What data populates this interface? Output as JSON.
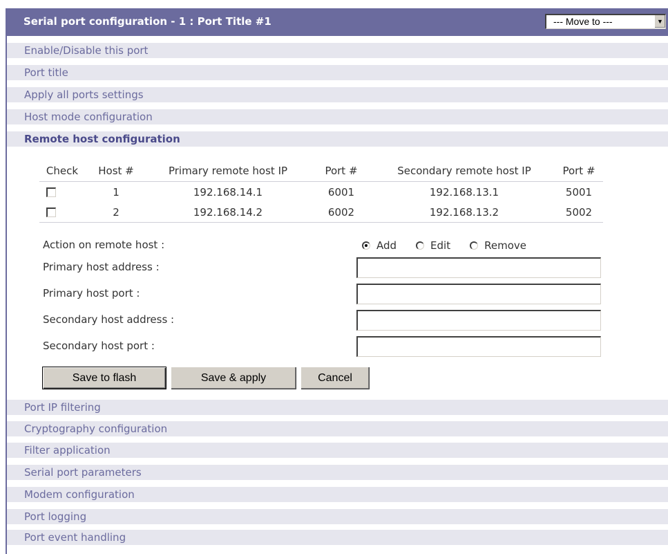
{
  "header": {
    "title": "Serial port configuration - 1 : Port Title #1",
    "move_to": "--- Move to ---"
  },
  "sections_top": [
    "Enable/Disable this port",
    "Port title",
    "Apply all ports settings",
    "Host mode configuration",
    "Remote host configuration"
  ],
  "hosts_table": {
    "columns": [
      "Check",
      "Host #",
      "Primary remote host IP",
      "Port #",
      "Secondary remote host IP",
      "Port #"
    ],
    "rows": [
      {
        "host": "1",
        "primary_ip": "192.168.14.1",
        "primary_port": "6001",
        "secondary_ip": "192.168.13.1",
        "secondary_port": "5001",
        "checked": false
      },
      {
        "host": "2",
        "primary_ip": "192.168.14.2",
        "primary_port": "6002",
        "secondary_ip": "192.168.13.2",
        "secondary_port": "5002",
        "checked": false
      }
    ]
  },
  "form": {
    "action_label": "Action on remote host :",
    "actions": [
      {
        "label": "Add",
        "selected": true
      },
      {
        "label": "Edit",
        "selected": false
      },
      {
        "label": "Remove",
        "selected": false
      }
    ],
    "primary_address_label": "Primary host address :",
    "primary_port_label": "Primary host port :",
    "secondary_address_label": "Secondary host address :",
    "secondary_port_label": "Secondary host port :",
    "primary_address_value": "",
    "primary_port_value": "",
    "secondary_address_value": "",
    "secondary_port_value": ""
  },
  "buttons": {
    "save_flash": "Save to flash",
    "save_apply": "Save & apply",
    "cancel": "Cancel"
  },
  "sections_bottom": [
    "Port IP filtering",
    "Cryptography configuration",
    "Filter application",
    "Serial port parameters",
    "Modem configuration",
    "Port logging",
    "Port event handling"
  ],
  "colors": {
    "header_bg": "#6b6b9e",
    "section_bg": "#e6e6ee",
    "section_text": "#6b6b9e",
    "button_face": "#d4d0c8"
  }
}
